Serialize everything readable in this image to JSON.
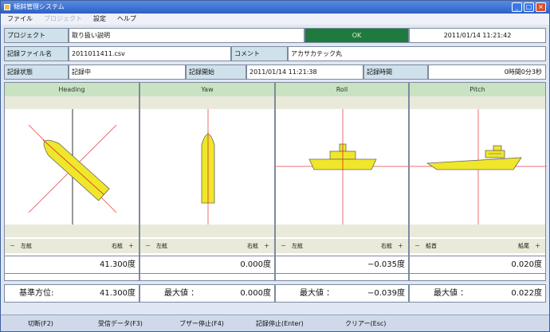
{
  "window": {
    "title": "傾斜管理システム"
  },
  "menu": [
    "ファイル",
    "プロジェクト",
    "設定",
    "ヘルプ"
  ],
  "info": {
    "project_label": "プロジェクト",
    "project_value": "取り扱い説明",
    "status_ok": "OK",
    "datetime": "2011/01/14 11:21:42",
    "file_label": "記録ファイル名",
    "file_value": "2011011411.csv",
    "comment_label": "コメント",
    "comment_value": "アカサカテック丸",
    "state_label": "記録状態",
    "state_value": "記録中",
    "start_label": "記録開始",
    "start_value": "2011/01/14 11:21:38",
    "elapsed_label": "記録時間",
    "elapsed_value": "0時間0分3秒"
  },
  "panels": [
    {
      "title": "Heading",
      "minus": "－",
      "left": "左舷",
      "right": "右舷",
      "plus": "＋",
      "value": "41.300度",
      "sub_label": "基準方位:",
      "sub_value": "41.300度"
    },
    {
      "title": "Yaw",
      "minus": "－",
      "left": "左舷",
      "right": "右舷",
      "plus": "＋",
      "value": "0.000度",
      "sub_label": "最大値 ：",
      "sub_value": "0.000度"
    },
    {
      "title": "Roll",
      "minus": "－",
      "left": "左舷",
      "right": "右舷",
      "plus": "＋",
      "value": "−0.035度",
      "sub_label": "最大値 ：",
      "sub_value": "−0.039度"
    },
    {
      "title": "Pitch",
      "minus": "－",
      "left": "船首",
      "right": "船尾",
      "plus": "＋",
      "value": "0.020度",
      "sub_label": "最大値 ：",
      "sub_value": "0.022度"
    }
  ],
  "function_keys": [
    "切断(F2)",
    "受信データ(F3)",
    "ブザー停止(F4)",
    "記録停止(Enter)",
    "クリアー(Esc)"
  ],
  "colors": {
    "ship": "#f0e62a",
    "ok_bg": "#1f7a3d",
    "header_bg": "#c9e3c2",
    "guide": "#e8706e"
  }
}
